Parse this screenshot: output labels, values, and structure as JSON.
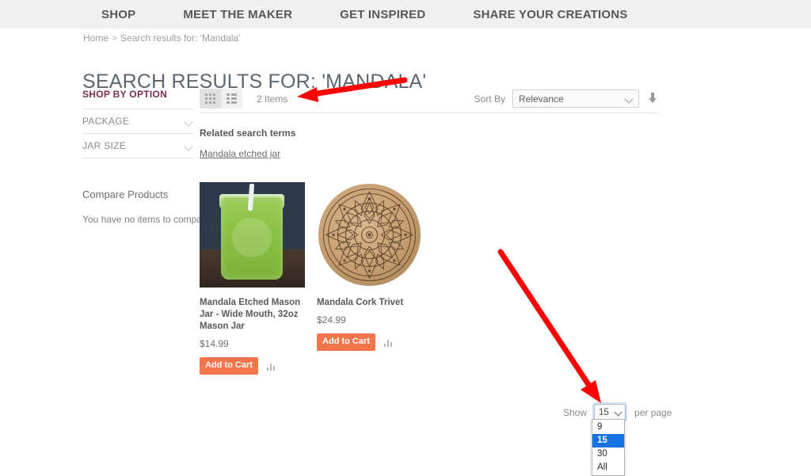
{
  "nav": {
    "items": [
      {
        "label": "SHOP",
        "name": "nav-item-shop"
      },
      {
        "label": "MEET THE MAKER",
        "name": "nav-item-meet-the-maker"
      },
      {
        "label": "GET INSPIRED",
        "name": "nav-item-get-inspired"
      },
      {
        "label": "SHARE YOUR CREATIONS",
        "name": "nav-item-share-your-creations"
      }
    ]
  },
  "breadcrumb": {
    "home": "Home",
    "separator": ">",
    "current": "Search results for: 'Mandala'"
  },
  "page": {
    "title": "SEARCH RESULTS FOR: 'MANDALA'"
  },
  "sidebar": {
    "shop_by_heading": "SHOP BY OPTION",
    "filters": [
      {
        "label": "PACKAGE"
      },
      {
        "label": "JAR SIZE"
      }
    ],
    "compare": {
      "title": "Compare Products",
      "empty_text": "You have no items to compare."
    }
  },
  "toolbar": {
    "view_modes": [
      {
        "name": "grid",
        "active": true
      },
      {
        "name": "list",
        "active": false
      }
    ],
    "item_count": "2 Items",
    "sort_by_label": "Sort By",
    "sort_value": "Relevance",
    "sort_options": [
      "Relevance"
    ],
    "sort_direction": "ascending"
  },
  "related": {
    "title": "Related search terms",
    "links": [
      "Mandala etched jar"
    ]
  },
  "products": [
    {
      "name": "Mandala Etched Mason Jar - Wide Mouth, 32oz Mason Jar",
      "price": "$14.99",
      "add_to_cart": "Add to Cart",
      "image_alt": "green-smoothie-mason-jar-photo"
    },
    {
      "name": "Mandala Cork Trivet",
      "price": "$24.99",
      "add_to_cart": "Add to Cart",
      "image_alt": "mandala-cork-trivet-photo"
    }
  ],
  "per_page": {
    "show_label": "Show",
    "value": "15",
    "suffix_label": "per page",
    "options": [
      {
        "label": "9",
        "selected": false
      },
      {
        "label": "15",
        "selected": true
      },
      {
        "label": "30",
        "selected": false
      },
      {
        "label": "All",
        "selected": false
      }
    ]
  },
  "colors": {
    "nav_background": "#f0f0f0",
    "shop_by_heading": "#7b2d52",
    "add_to_cart": "#f2764b",
    "option_highlight": "#1673e6",
    "annotation_arrow": "#fe0000",
    "page_title": "#5c6670"
  }
}
